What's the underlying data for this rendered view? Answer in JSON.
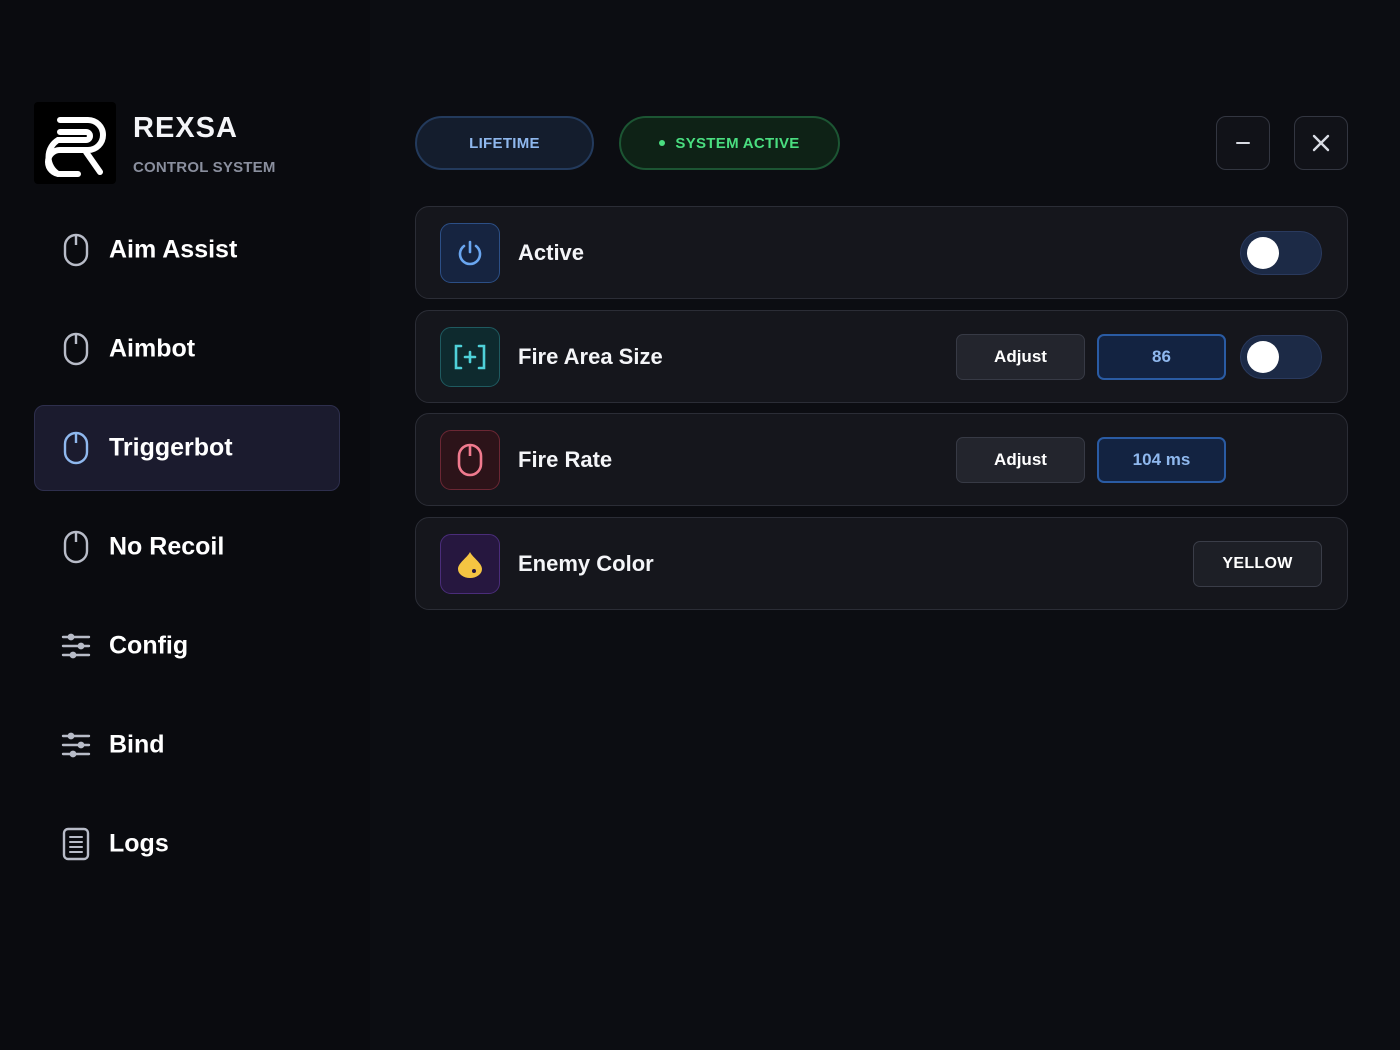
{
  "brand": {
    "title": "REXSA",
    "subtitle": "CONTROL SYSTEM"
  },
  "sidebar": {
    "items": [
      {
        "label": "Aim Assist",
        "icon": "mouse-icon",
        "active": false
      },
      {
        "label": "Aimbot",
        "icon": "mouse-icon",
        "active": false
      },
      {
        "label": "Triggerbot",
        "icon": "mouse-icon",
        "active": true
      },
      {
        "label": "No Recoil",
        "icon": "mouse-icon",
        "active": false
      },
      {
        "label": "Config",
        "icon": "sliders-icon",
        "active": false
      },
      {
        "label": "Bind",
        "icon": "sliders-icon",
        "active": false
      },
      {
        "label": "Logs",
        "icon": "document-icon",
        "active": false
      }
    ]
  },
  "header": {
    "license_label": "LIFETIME",
    "status_label": "SYSTEM ACTIVE",
    "minimize_symbol": "–",
    "close_symbol": "✕"
  },
  "settings": [
    {
      "label": "Active",
      "icon": "power-icon",
      "toggle": "off"
    },
    {
      "label": "Fire Area Size",
      "icon": "crosshair-expand-icon",
      "adjust_label": "Adjust",
      "value": "86",
      "toggle": "off"
    },
    {
      "label": "Fire Rate",
      "icon": "mouse-icon",
      "adjust_label": "Adjust",
      "value": "104 ms"
    },
    {
      "label": "Enemy Color",
      "icon": "color-drop-icon",
      "color_value": "YELLOW"
    }
  ],
  "colors": {
    "accent_blue": "#8fb8ee",
    "status_green": "#4ade80",
    "active_nav_bg": "#1b1b2e",
    "enemy_color_swatch": "#f5c542"
  }
}
